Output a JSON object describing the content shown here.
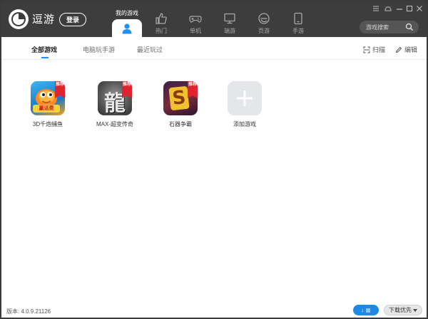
{
  "app": {
    "brand": "逗游",
    "login_label": "登录"
  },
  "nav": {
    "tabs": [
      {
        "label": "我的游戏",
        "icon": "user-icon",
        "active": true
      },
      {
        "label": "热门",
        "icon": "thumbs-up-icon"
      },
      {
        "label": "单机",
        "icon": "gamepad-icon"
      },
      {
        "label": "端游",
        "icon": "monitor-icon"
      },
      {
        "label": "页游",
        "icon": "browser-e-icon"
      },
      {
        "label": "手游",
        "icon": "phone-icon"
      }
    ]
  },
  "search": {
    "placeholder": "游戏搜索"
  },
  "subtabs": {
    "items": [
      "全部游戏",
      "电脑玩手游",
      "最近玩过"
    ],
    "active_index": 0,
    "scan_label": "扫描",
    "edit_label": "编辑"
  },
  "games": [
    {
      "name": "3D千炮捕鱼",
      "badge": "推荐",
      "thumb_text": "赢话费"
    },
    {
      "name": "MAX-超变传奇",
      "badge": "推荐",
      "thumb_text": "龍"
    },
    {
      "name": "石器争霸",
      "badge": "推荐",
      "thumb_text": "S"
    },
    {
      "name": "添加游戏"
    }
  ],
  "footer": {
    "version": "版本: 4.0.9.21126",
    "download_label": "↓",
    "download_priority_label": "下载优先"
  },
  "colors": {
    "topbar": "#3d3d3d",
    "accent": "#1e88e5",
    "badge": "#e0242f"
  }
}
